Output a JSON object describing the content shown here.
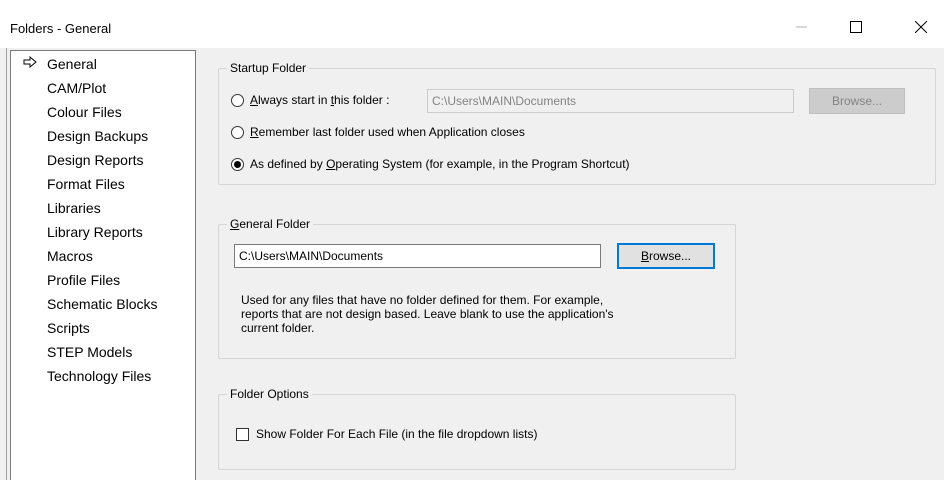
{
  "window": {
    "title": "Folders - General",
    "controls": {
      "minimize": "minimize-icon",
      "maximize": "maximize-icon",
      "close": "close-icon"
    }
  },
  "tree": {
    "items": [
      {
        "label": "General",
        "selected": true
      },
      {
        "label": "CAM/Plot"
      },
      {
        "label": "Colour Files"
      },
      {
        "label": "Design Backups"
      },
      {
        "label": "Design Reports"
      },
      {
        "label": "Format Files"
      },
      {
        "label": "Libraries"
      },
      {
        "label": "Library Reports"
      },
      {
        "label": "Macros"
      },
      {
        "label": "Profile Files"
      },
      {
        "label": "Schematic Blocks"
      },
      {
        "label": "Scripts"
      },
      {
        "label": "STEP Models"
      },
      {
        "label": "Technology Files"
      }
    ]
  },
  "startup": {
    "title": "Startup Folder",
    "options": [
      {
        "pre": "",
        "mn": "A",
        "post": "lways start in ",
        "mn2": "t",
        "post2": "his folder :"
      },
      {
        "pre": "",
        "mn": "R",
        "post": "emember last folder used when Application closes"
      },
      {
        "pre": "As defined by ",
        "mn": "O",
        "post": "perating System (for example, in the Program Shortcut)"
      }
    ],
    "selected_index": 2,
    "path": "C:\\Users\\MAIN\\Documents",
    "browse_label": "Browse..."
  },
  "general": {
    "title_mn": "G",
    "title_rest": "eneral Folder",
    "path": "C:\\Users\\MAIN\\Documents",
    "browse_mn": "B",
    "browse_rest": "rowse...",
    "desc": [
      "Used for any files that have no folder defined for them.  For example,",
      "reports that are not design based.  Leave blank to use the application's",
      "current folder."
    ]
  },
  "options": {
    "title": "Folder Options",
    "checkbox_label": "Show Folder For Each File (in the file dropdown lists)",
    "checked": false
  }
}
